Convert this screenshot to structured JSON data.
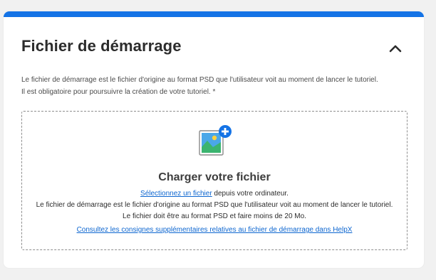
{
  "section": {
    "title": "Fichier de démarrage",
    "description_line1": "Le fichier de démarrage est le fichier d'origine au format PSD que l'utilisateur voit au moment de lancer le tutoriel.",
    "description_line2": "Il est obligatoire pour poursuivre la création de votre tutoriel. *"
  },
  "dropzone": {
    "icon": "image-add-icon",
    "title": "Charger votre fichier",
    "select_link": "Sélectionnez un fichier",
    "select_suffix": " depuis votre ordinateur.",
    "line2": "Le fichier de démarrage est le fichier d'origine au format PSD que l'utilisateur voit au moment de lancer le tutoriel.",
    "line3": "Le fichier doit être au format PSD et faire moins de 20 Mo.",
    "helpx_link": "Consultez les consignes supplémentaires relatives au fichier de démarrage dans HelpX"
  },
  "colors": {
    "accent": "#1473e6",
    "link": "#0d66d0",
    "plus_badge": "#1473e6"
  },
  "icons": {
    "collapse": "chevron-up-icon"
  }
}
